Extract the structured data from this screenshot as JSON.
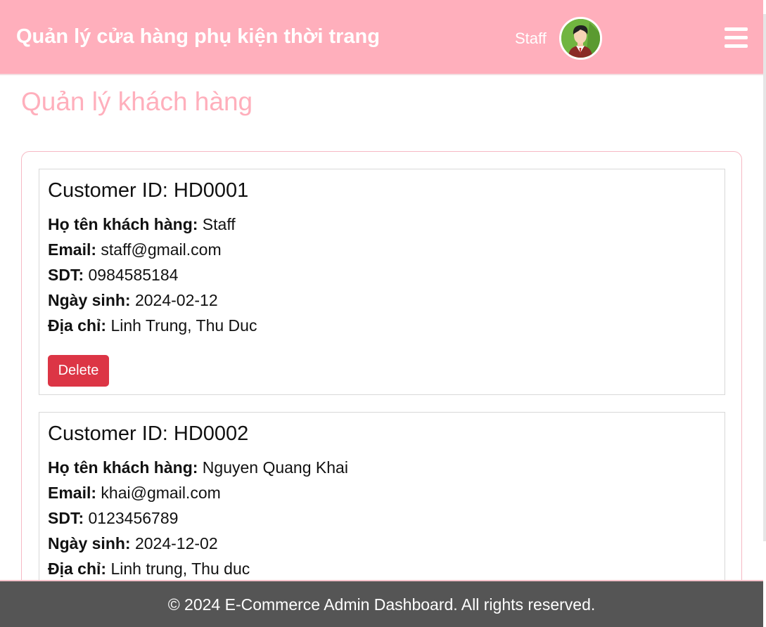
{
  "header": {
    "title": "Quản lý cửa hàng phụ kiện thời trang",
    "user_name": "Staff",
    "avatar_icon": "user-avatar-icon",
    "menu_icon": "hamburger-menu-icon"
  },
  "page_title": "Quản lý khách hàng",
  "labels": {
    "id_prefix": "Customer ID: ",
    "name": "Họ tên khách hàng:",
    "email": "Email:",
    "phone": "SDT:",
    "dob": "Ngày sinh:",
    "address": "Địa chỉ:",
    "delete": "Delete"
  },
  "customers": [
    {
      "id": "HD0001",
      "name": "Staff",
      "email": "staff@gmail.com",
      "phone": "0984585184",
      "dob": "2024-02-12",
      "address": "Linh Trung, Thu Duc"
    },
    {
      "id": "HD0002",
      "name": "Nguyen Quang Khai",
      "email": "khai@gmail.com",
      "phone": "0123456789",
      "dob": "2024-12-02",
      "address": "Linh trung, Thu duc"
    }
  ],
  "footer": {
    "text": "© 2024 E-Commerce Admin Dashboard. All rights reserved."
  },
  "colors": {
    "header_bg": "#ffafbc",
    "title_pink": "#ffafbc",
    "delete_red": "#dc3545",
    "footer_bg": "#555555"
  }
}
